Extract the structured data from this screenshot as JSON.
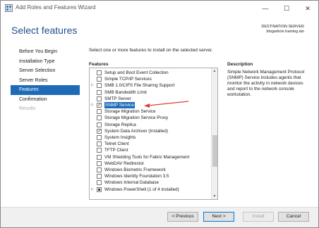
{
  "window": {
    "title": "Add Roles and Features Wizard",
    "minimize_glyph": "—",
    "maximize_glyph": "☐",
    "close_glyph": "✕"
  },
  "header": {
    "title": "Select features",
    "destination_label": "DESTINATION SERVER",
    "destination_server": "blogarticle.training.lan"
  },
  "nav": {
    "items": [
      {
        "label": "Before You Begin",
        "state": "normal"
      },
      {
        "label": "Installation Type",
        "state": "normal"
      },
      {
        "label": "Server Selection",
        "state": "normal"
      },
      {
        "label": "Server Roles",
        "state": "normal"
      },
      {
        "label": "Features",
        "state": "active"
      },
      {
        "label": "Confirmation",
        "state": "normal"
      },
      {
        "label": "Results",
        "state": "disabled"
      }
    ]
  },
  "main": {
    "instruction": "Select one or more features to install on the selected server.",
    "features_heading": "Features",
    "features": [
      {
        "label": "Setup and Boot Event Collection",
        "check": "unchecked",
        "expander": ""
      },
      {
        "label": "Simple TCP/IP Services",
        "check": "unchecked",
        "expander": ""
      },
      {
        "label": "SMB 1.0/CIFS File Sharing Support",
        "check": "unchecked",
        "expander": "▷"
      },
      {
        "label": "SMB Bandwidth Limit",
        "check": "unchecked",
        "expander": ""
      },
      {
        "label": "SMTP Server",
        "check": "unchecked",
        "expander": ""
      },
      {
        "label": "SNMP Service",
        "check": "checked",
        "expander": "▷",
        "selected": true
      },
      {
        "label": "Storage Migration Service",
        "check": "unchecked",
        "expander": ""
      },
      {
        "label": "Storage Migration Service Proxy",
        "check": "unchecked",
        "expander": ""
      },
      {
        "label": "Storage Replica",
        "check": "unchecked",
        "expander": ""
      },
      {
        "label": "System Data Archiver (Installed)",
        "check": "checked",
        "expander": ""
      },
      {
        "label": "System Insights",
        "check": "unchecked",
        "expander": ""
      },
      {
        "label": "Telnet Client",
        "check": "unchecked",
        "expander": ""
      },
      {
        "label": "TFTP Client",
        "check": "unchecked",
        "expander": ""
      },
      {
        "label": "VM Shielding Tools for Fabric Management",
        "check": "unchecked",
        "expander": ""
      },
      {
        "label": "WebDAV Redirector",
        "check": "unchecked",
        "expander": ""
      },
      {
        "label": "Windows Biometric Framework",
        "check": "unchecked",
        "expander": ""
      },
      {
        "label": "Windows Identity Foundation 3.5",
        "check": "unchecked",
        "expander": ""
      },
      {
        "label": "Windows Internal Database",
        "check": "unchecked",
        "expander": ""
      },
      {
        "label": "Windows PowerShell (1 of 4 installed)",
        "check": "partial",
        "expander": "▷"
      }
    ],
    "description_heading": "Description",
    "description": "Simple Network Management Protocol (SNMP) Service includes agents that monitor the activity in network devices and report to the network console workstation."
  },
  "footer": {
    "previous_label": "< Previous",
    "next_label": "Next >",
    "install_label": "Install",
    "cancel_label": "Cancel"
  },
  "colors": {
    "accent": "#1f6bb8",
    "title": "#1f4e8c",
    "annotation_arrow": "#e53935"
  }
}
